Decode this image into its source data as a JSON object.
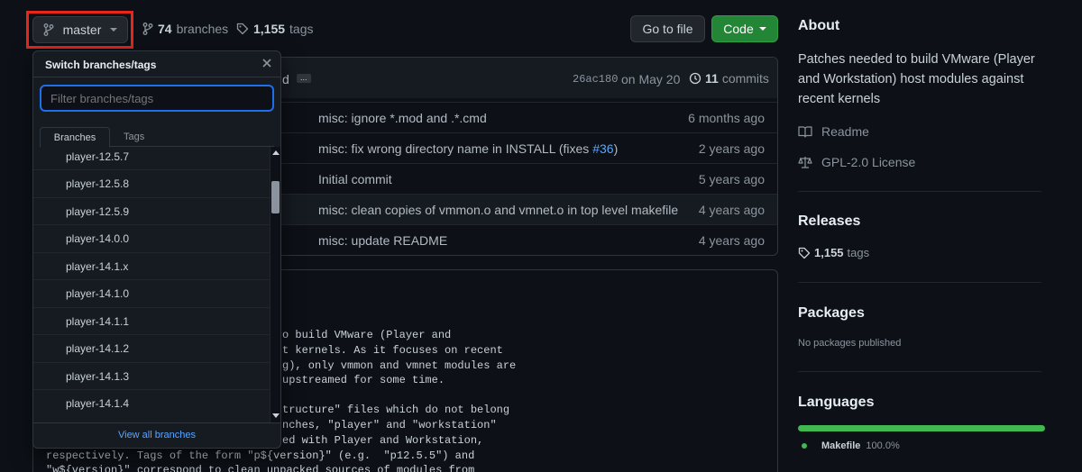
{
  "branch_bar": {
    "current_branch": "master",
    "branches_count": "74",
    "branches_label": "branches",
    "tags_count": "1,155",
    "tags_label": "tags"
  },
  "actions": {
    "go_to_file": "Go to file",
    "code": "Code"
  },
  "commit_bar": {
    "author_tail": "d",
    "ellipsis": "...",
    "sha": "26ac180",
    "date": "on May 20",
    "commits_count": "11",
    "commits_label": "commits"
  },
  "files": [
    {
      "message": "misc: ignore *.mod and .*.cmd",
      "age": "6 months ago"
    },
    {
      "message_prefix": "misc: fix wrong directory name in INSTALL (fixes ",
      "issue_link": "#36",
      "message_suffix": ")",
      "age": "2 years ago"
    },
    {
      "message": "Initial commit",
      "age": "5 years ago"
    },
    {
      "message": "misc: clean copies of vmmon.o and vmnet.o in top level makefile",
      "age": "4 years ago"
    },
    {
      "message": "misc: update README",
      "age": "4 years ago"
    }
  ],
  "readme": {
    "lines": [
      "o build VMware (Player and",
      "t kernels. As it focuses on recent",
      "g), only vmmon and vmnet modules are",
      "upstreamed for some time.",
      "tructure\" files which do not belong",
      "nches, \"player\" and \"workstation\"",
      "ed with Player and Workstation,",
      "respectively. Tags of the form \"p${version}\" (e.g.  \"p12.5.5\") and",
      "\"w${version}\" correspond to clean unpacked sources of modules from"
    ]
  },
  "dropdown": {
    "title": "Switch branches/tags",
    "filter_placeholder": "Filter branches/tags",
    "tab_branches": "Branches",
    "tab_tags": "Tags",
    "items": [
      "player-12.5.7",
      "player-12.5.8",
      "player-12.5.9",
      "player-14.0.0",
      "player-14.1.x",
      "player-14.1.0",
      "player-14.1.1",
      "player-14.1.2",
      "player-14.1.3",
      "player-14.1.4"
    ],
    "view_all": "View all branches"
  },
  "about": {
    "heading": "About",
    "description": "Patches needed to build VMware (Player and Workstation) host modules against recent kernels",
    "readme": "Readme",
    "license": "GPL-2.0 License"
  },
  "releases": {
    "heading": "Releases",
    "tags_count": "1,155",
    "tags_label": "tags"
  },
  "packages": {
    "heading": "Packages",
    "empty": "No packages published"
  },
  "languages": {
    "heading": "Languages",
    "name": "Makefile",
    "percent": "100.0%",
    "share": 1.0,
    "color": "#3fb950"
  },
  "colors": {
    "accent_green": "#238636",
    "link_blue": "#58a6ff",
    "highlight_red": "#e8261a"
  }
}
